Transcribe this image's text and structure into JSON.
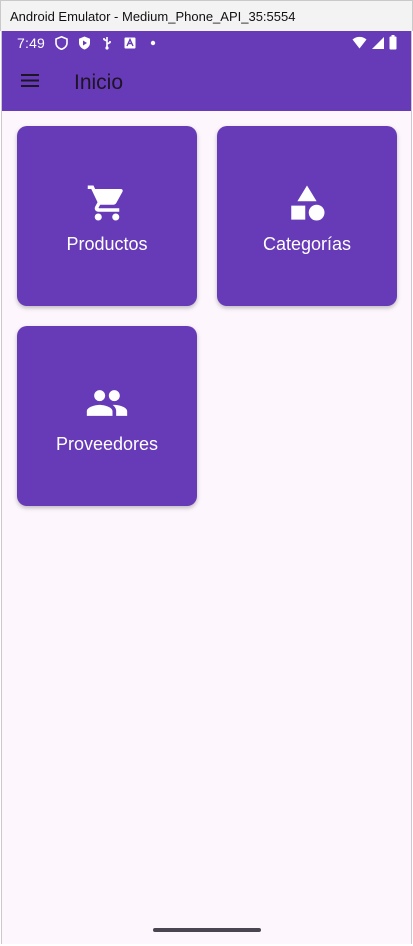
{
  "window": {
    "title": "Android Emulator - Medium_Phone_API_35:5554"
  },
  "statusbar": {
    "time": "7:49"
  },
  "appbar": {
    "title": "Inicio"
  },
  "tiles": [
    {
      "label": "Productos",
      "icon": "shopping-cart-icon"
    },
    {
      "label": "Categorías",
      "icon": "category-shapes-icon"
    },
    {
      "label": "Proveedores",
      "icon": "people-icon"
    }
  ],
  "colors": {
    "primary": "#673ab7",
    "background": "#fdf7fd",
    "on_primary": "#ffffff"
  }
}
